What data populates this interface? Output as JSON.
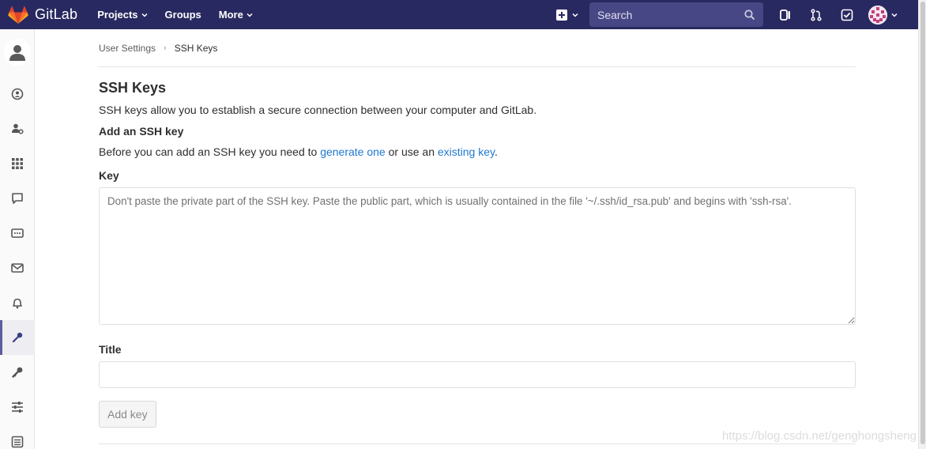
{
  "navbar": {
    "brand": "GitLab",
    "links": [
      {
        "label": "Projects"
      },
      {
        "label": "Groups"
      },
      {
        "label": "More"
      }
    ],
    "search_placeholder": "Search"
  },
  "breadcrumb": {
    "parent": "User Settings",
    "current": "SSH Keys"
  },
  "page": {
    "title": "SSH Keys",
    "description": "SSH keys allow you to establish a secure connection between your computer and GitLab.",
    "add_heading": "Add an SSH key",
    "before_text_1": "Before you can add an SSH key you need to",
    "generate_link": "generate one",
    "before_text_2": "or use an",
    "existing_link": "existing key",
    "before_text_3": ".",
    "key_label": "Key",
    "key_placeholder": "Don't paste the private part of the SSH key. Paste the public part, which is usually contained in the file '~/.ssh/id_rsa.pub' and begins with 'ssh-rsa'.",
    "key_value": "",
    "title_label": "Title",
    "title_value": "",
    "add_button": "Add key"
  },
  "watermark": "https://blog.csdn.net/genghongsheng",
  "colors": {
    "navbar": "#292961",
    "search_bg": "#474785",
    "link": "#1f78d1",
    "sidebar_active": "#5c5c9e"
  },
  "sidebar_icons": [
    "user-avatar-icon",
    "profile-icon",
    "account-icon",
    "applications-icon",
    "chat-icon",
    "access-tokens-icon",
    "emails-icon",
    "notifications-icon",
    "ssh-keys-icon",
    "gpg-keys-icon",
    "preferences-icon",
    "authentication-log-icon"
  ]
}
